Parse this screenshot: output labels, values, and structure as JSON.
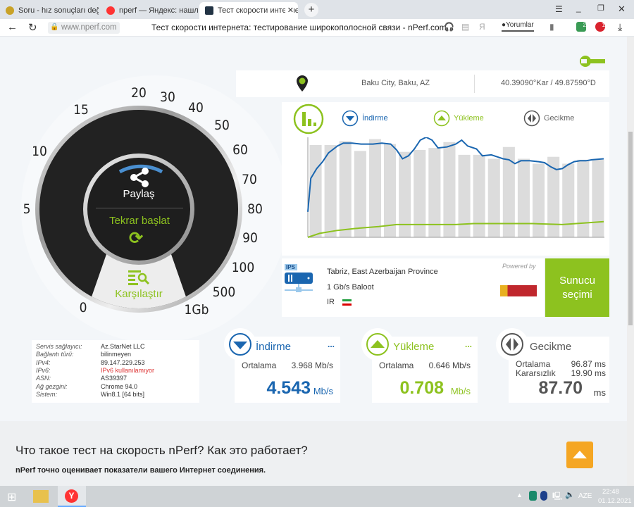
{
  "browser": {
    "tabs": [
      {
        "label": "Soru - hız sonuçları değerle"
      },
      {
        "label": "nperf — Яндекс: нашлось"
      },
      {
        "label": "Тест скорости интернета"
      }
    ],
    "new_tab": "+",
    "url": "www.nperf.com",
    "page_title": "Тест скорости интернета: тестирование широкополосной связи - nPerf.com",
    "comments": "Yorumlar",
    "ext_badge1": "2",
    "ext_badge2": "1"
  },
  "location": {
    "city": "Baku City, Baku, AZ",
    "coords": "40.39090°Kar / 49.87590°D"
  },
  "gauge": {
    "labels": [
      "0",
      "5",
      "10",
      "15",
      "20",
      "30",
      "40",
      "50",
      "60",
      "70",
      "80",
      "90",
      "100",
      "500",
      "1Gb"
    ],
    "share": "Paylaş",
    "restart": "Tekrar başlat",
    "compare": "Karşılaştır"
  },
  "legend": {
    "download": "İndirme",
    "upload": "Yükleme",
    "ping": "Gecikme"
  },
  "chart_data": {
    "type": "bar+line",
    "bars": [
      94,
      94,
      98,
      88,
      100,
      95,
      87,
      89,
      91,
      97,
      84,
      84,
      80,
      92,
      80,
      75,
      82,
      75,
      79,
      79
    ],
    "download": [
      [
        0,
        26
      ],
      [
        1,
        60
      ],
      [
        3,
        70
      ],
      [
        5,
        77
      ],
      [
        7,
        86
      ],
      [
        10,
        93
      ],
      [
        12,
        96
      ],
      [
        15,
        96
      ],
      [
        18,
        95
      ],
      [
        22,
        95
      ],
      [
        25,
        96
      ],
      [
        28,
        95
      ],
      [
        30,
        89
      ],
      [
        32,
        80
      ],
      [
        34,
        83
      ],
      [
        36,
        90
      ],
      [
        38,
        99
      ],
      [
        40,
        102
      ],
      [
        42,
        99
      ],
      [
        44,
        91
      ],
      [
        47,
        92
      ],
      [
        50,
        95
      ],
      [
        52,
        99
      ],
      [
        54,
        93
      ],
      [
        57,
        90
      ],
      [
        59,
        83
      ],
      [
        62,
        84
      ],
      [
        64,
        82
      ],
      [
        66,
        80
      ],
      [
        68,
        79
      ],
      [
        70,
        75
      ],
      [
        72,
        78
      ],
      [
        75,
        78
      ],
      [
        78,
        77
      ],
      [
        80,
        76
      ],
      [
        82,
        72
      ],
      [
        84,
        69
      ],
      [
        86,
        70
      ],
      [
        88,
        74
      ],
      [
        90,
        77
      ],
      [
        92,
        78
      ],
      [
        94,
        78
      ],
      [
        96,
        79
      ],
      [
        100,
        80
      ]
    ],
    "upload": [
      [
        0,
        0
      ],
      [
        4,
        4
      ],
      [
        10,
        7
      ],
      [
        16,
        9
      ],
      [
        24,
        11
      ],
      [
        30,
        13
      ],
      [
        40,
        13
      ],
      [
        50,
        13
      ],
      [
        56,
        14
      ],
      [
        64,
        14
      ],
      [
        76,
        14
      ],
      [
        86,
        13
      ],
      [
        100,
        16
      ]
    ],
    "ylim": [
      0,
      110
    ]
  },
  "server": {
    "location": "Tabriz, East Azerbaijan Province",
    "isp": "1 Gb/s Baloot",
    "country": "IR",
    "powered_by": "Powered by",
    "badge": "IPS",
    "select_button": "Sunucu seçimi"
  },
  "info": [
    {
      "k": "Servis sağlayıcı:",
      "v": "Az.StarNet LLC"
    },
    {
      "k": "Bağlantı türü:",
      "v": "bilinmeyen"
    },
    {
      "k": "IPv4:",
      "v": "89.147.229.253"
    },
    {
      "k": "IPv6:",
      "v": "IPv6 kullanılamıyor"
    },
    {
      "k": "ASN:",
      "v": "AS39397"
    },
    {
      "k": "Ağ gezgini:",
      "v": "Chrome 94.0"
    },
    {
      "k": "Sistem:",
      "v": "Win8.1 [64 bits]"
    }
  ],
  "download": {
    "title": "İndirme",
    "more": "...",
    "avg_label": "Ortalama",
    "avg": "3.968 Mb/s",
    "value": "4.543",
    "unit": "Mb/s"
  },
  "upload": {
    "title": "Yükleme",
    "more": "...",
    "avg_label": "Ortalama",
    "avg": "0.646 Mb/s",
    "value": "0.708",
    "unit": "Mb/s"
  },
  "ping": {
    "title": "Gecikme",
    "avg_label": "Ortalama",
    "avg": "96.87 ms",
    "jitter_label": "Kararsızlık",
    "jitter": "19.90 ms",
    "value": "87.70",
    "unit": "ms"
  },
  "faq": {
    "heading": "Что такое тест на скорость nPerf? Как это работает?",
    "text": "nPerf точно оценивает показатели вашего Интернет соединения."
  },
  "taskbar": {
    "lang": "AZE",
    "time": "22:48",
    "date": "01.12.2021"
  },
  "colors": {
    "blue": "#1a66b0",
    "green": "#8dc21f",
    "grey": "#555"
  }
}
